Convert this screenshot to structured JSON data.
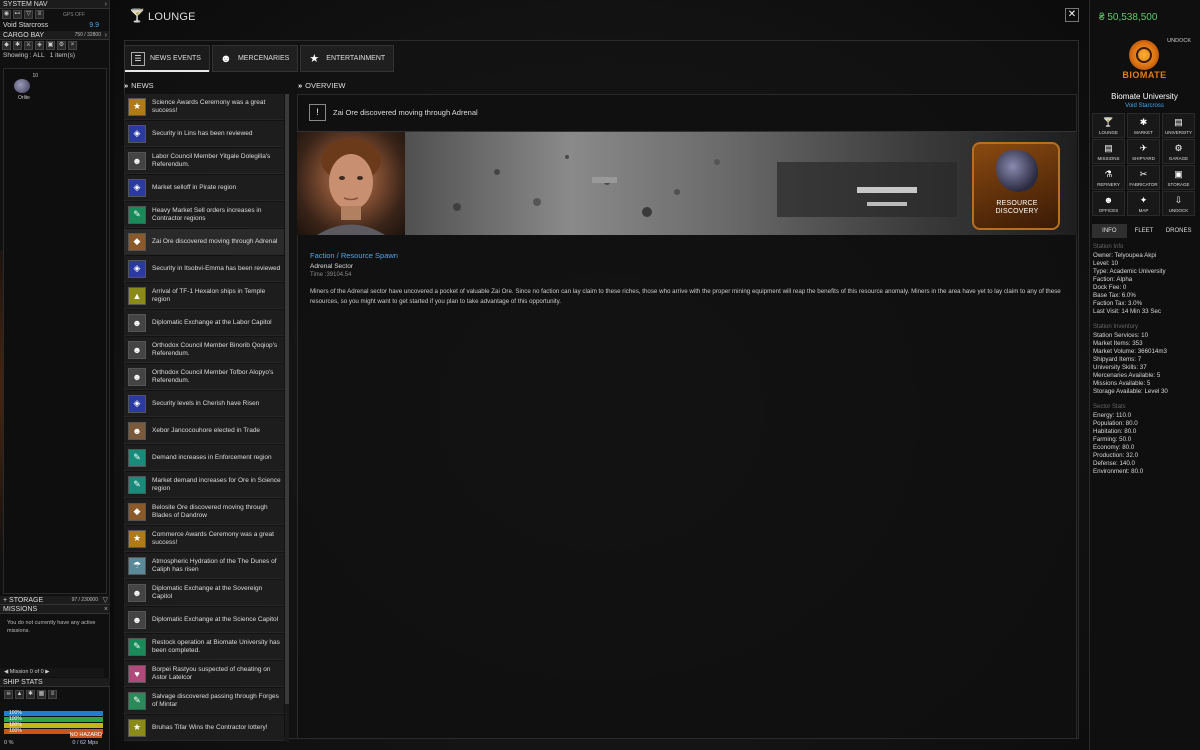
{
  "left": {
    "system_nav": "SYSTEM NAV",
    "gps_label": "GPS OFF",
    "nav_location": "Void Starcross",
    "nav_distance": "9.9",
    "cargo_bay": "CARGO BAY",
    "cargo_capacity": "750 / 32800",
    "cargo_filter": "Showing : ALL",
    "cargo_count": "1 item(s)",
    "cargo_item_qty": "10",
    "cargo_item_label": "Orlite",
    "storage": "STORAGE",
    "storage_capacity": "97 / 230000",
    "missions": "MISSIONS",
    "missions_empty": "You do not currently have any active missions.",
    "mission_nav": "Mission 0 of 0",
    "ship_stats": "SHIP STATS",
    "stat_bars": [
      {
        "label": "100%",
        "color": "#1e7fd0"
      },
      {
        "label": "100%",
        "color": "#27a64b"
      },
      {
        "label": "100%",
        "color": "#c9b21a"
      },
      {
        "label": "100%",
        "color": "#c9561a"
      }
    ],
    "hazard": "NO HAZARD",
    "fuel": "0 %",
    "speed": "0 / 62 Mps"
  },
  "main": {
    "title": "LOUNGE",
    "tabs": [
      {
        "label": "NEWS EVENTS",
        "icon": "news-icon"
      },
      {
        "label": "MERCENARIES",
        "icon": "mercenary-icon"
      },
      {
        "label": "ENTERTAINMENT",
        "icon": "star-icon"
      }
    ],
    "news_header": "NEWS",
    "overview_header": "OVERVIEW",
    "news": [
      {
        "text": "Science Awards Ceremony was a great success!",
        "color": "#b07a1a"
      },
      {
        "text": "Security in Lins has been reviewed",
        "color": "#2a3aa0"
      },
      {
        "text": "Labor Council Member Yitgale Dolegilla's Referendum.",
        "color": "#444"
      },
      {
        "text": "Market selloff in Pirate region",
        "color": "#2a3aa0"
      },
      {
        "text": "Heavy Market Sell orders increases in Contractor regions",
        "color": "#1a8a5a"
      },
      {
        "text": "Zai Ore discovered moving through Adrenal",
        "color": "#8a5a2a"
      },
      {
        "text": "Security in Itsobvi-Emma has been reviewed",
        "color": "#2a3aa0"
      },
      {
        "text": "Arrival of TF-1 Hexalon ships in Temple region",
        "color": "#8a8a1a"
      },
      {
        "text": "Diplomatic Exchange at the Labor Capitol",
        "color": "#444"
      },
      {
        "text": "Orthodox Council Member Binorib Qoqiop's Referendum.",
        "color": "#444"
      },
      {
        "text": "Orthodox Council Member Tofbor Alopyo's Referendum.",
        "color": "#444"
      },
      {
        "text": "Security levels in Cherish have Risen",
        "color": "#2a3aa0"
      },
      {
        "text": "Xebor Jancocouhore elected in Trade",
        "color": "#7a5a3a"
      },
      {
        "text": "Demand increases in Enforcement region",
        "color": "#1a8a7a"
      },
      {
        "text": "Market demand increases for Ore in Science region",
        "color": "#1a8a7a"
      },
      {
        "text": "Belosite Ore discovered moving through Blades of Dandrow",
        "color": "#8a5a2a"
      },
      {
        "text": "Commerce Awards Ceremony was a great success!",
        "color": "#b07a1a"
      },
      {
        "text": "Atmospheric Hydration of the The Dunes of Caliph has risen",
        "color": "#5a8a9a"
      },
      {
        "text": "Diplomatic Exchange at the Sovereign Capitol",
        "color": "#444"
      },
      {
        "text": "Diplomatic Exchange at the Science Capitol",
        "color": "#444"
      },
      {
        "text": "Restock operation at Biomate University has been completed.",
        "color": "#1a8a5a"
      },
      {
        "text": "Borpei Rastyou suspected of cheating on Astor Latelcor",
        "color": "#b04a7a"
      },
      {
        "text": "Salvage discovered passing through Forges of Mintar",
        "color": "#2a8a5a"
      },
      {
        "text": "Bruhas Tifar Wins the Contractor lottery!",
        "color": "#8a8a1a"
      }
    ],
    "overview": {
      "headline": "Zai Ore discovered moving through Adrenal",
      "badge_text": "RESOURCE DISCOVERY",
      "category": "Faction / Resource Spawn",
      "sector": "Adrenal Sector",
      "time": "Time :39104.54",
      "body": "Miners of the Adrenal sector have uncovered a pocket of valuable Zai Ore. Since no faction can lay claim to these riches, those who arrive with the proper mining equipment will reap the benefits of this resource anomaly. Miners in the area have yet to lay claim to any of these resources, so you might want to get started if you plan to take advantage of this opportunity."
    }
  },
  "right": {
    "credits": "50,538,500",
    "undock": "UNDOCK",
    "brand": "BIOMATE",
    "station_name": "Biomate University",
    "system": "Void Starcross",
    "buttons": [
      {
        "label": "LOUNGE",
        "icon": "lounge-icon"
      },
      {
        "label": "MARKET",
        "icon": "market-icon"
      },
      {
        "label": "UNIVERSITY",
        "icon": "university-icon"
      },
      {
        "label": "MISSIONS",
        "icon": "missions-icon"
      },
      {
        "label": "SHIPYARD",
        "icon": "shipyard-icon"
      },
      {
        "label": "GARAGE",
        "icon": "garage-icon"
      },
      {
        "label": "REFINERY",
        "icon": "refinery-icon"
      },
      {
        "label": "FABRICATOR",
        "icon": "fabricator-icon"
      },
      {
        "label": "STORAGE",
        "icon": "storage-icon"
      },
      {
        "label": "OFFICES",
        "icon": "offices-icon"
      },
      {
        "label": "MAP",
        "icon": "map-icon"
      },
      {
        "label": "UNDOCK",
        "icon": "undock-icon"
      }
    ],
    "tabs": [
      "INFO",
      "FLEET",
      "DRONES"
    ],
    "station_info_hdr": "Station Info",
    "station_info": [
      "Owner: Telyoupea Akpi",
      "Level: 10",
      "Type: Academic University",
      "Faction: Alpha",
      "Dock Fee: 0",
      "Base Tax: 6.0%",
      "Faction Tax: 3.0%",
      "Last Visit: 14 Min 33 Sec"
    ],
    "inventory_hdr": "Station Inventory",
    "inventory": [
      "Station Services: 10",
      "Market Items: 353",
      "Market Volume: 366014m3",
      "Shipyard Items: 7",
      "University Skills: 37",
      "Mercenaries Available: 5",
      "Missions Available: 5",
      "Storage Available: Level 30"
    ],
    "sector_hdr": "Sector Stats",
    "sector": [
      "Energy: 110.0",
      "Population: 80.0",
      "Habitation: 80.0",
      "Farming: 50.0",
      "Economy: 80.0",
      "Production: 32.0",
      "Defense: 140.0",
      "Environment: 80.0"
    ]
  }
}
